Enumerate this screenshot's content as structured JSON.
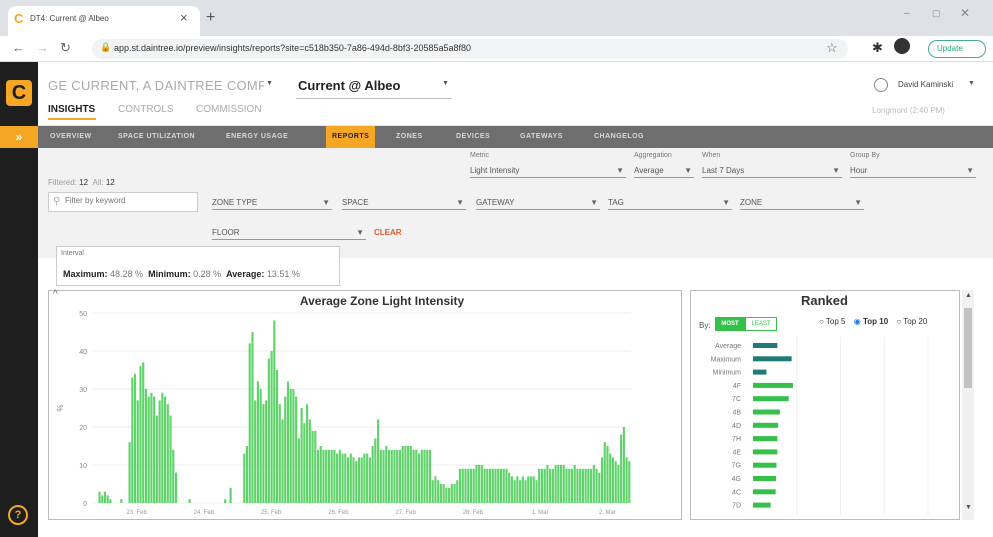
{
  "browser": {
    "tab_title": "DT4: Current @ Albeo",
    "tab_close": "×",
    "new_tab": "+",
    "url": "app.st.daintree.io/preview/insights/reports?site=c518b350-7a86-494d-8bf3-20585a5a8f80",
    "update_label": "Update"
  },
  "app": {
    "org_name": "GE CURRENT, A DAINTREE COMPANY",
    "site_name": "Current @ Albeo",
    "user_name": "David Kaminski",
    "location_time": "Longmont (2:40 PM)",
    "main_tabs": [
      "INSIGHTS",
      "CONTROLS",
      "COMMISSION"
    ],
    "sub_tabs": [
      "OVERVIEW",
      "SPACE UTILIZATION",
      "ENERGY USAGE",
      "REPORTS",
      "ZONES",
      "DEVICES",
      "GATEWAYS",
      "CHANGELOG"
    ],
    "active_sub_tab": "REPORTS"
  },
  "filters": {
    "metric_label": "Metric",
    "metric_value": "Light Intensity",
    "aggregation_label": "Aggregation",
    "aggregation_value": "Average",
    "when_label": "When",
    "when_value": "Last 7 Days",
    "groupby_label": "Group By",
    "groupby_value": "Hour",
    "filtered_label": "Filtered:",
    "filtered_count": "12",
    "all_label": "All:",
    "all_count": "12",
    "search_placeholder": "Filter by keyword",
    "zone_type": "ZONE TYPE",
    "space": "SPACE",
    "gateway": "GATEWAY",
    "tag": "TAG",
    "zone": "ZONE",
    "floor": "FLOOR",
    "clear": "CLEAR"
  },
  "interval": {
    "title": "Interval",
    "max_label": "Maximum:",
    "max_value": "48.28 %",
    "min_label": "Minimum:",
    "min_value": "0.28 %",
    "avg_label": "Average:",
    "avg_value": "13.51 %"
  },
  "ranked": {
    "title": "Ranked",
    "by_label": "By:",
    "most_label": "MOST",
    "least_label": "LEAST",
    "top_options": [
      "Top 5",
      "Top 10",
      "Top 20"
    ],
    "selected_top": "Top 10"
  },
  "colors": {
    "accent": "#f5a623",
    "bar_green": "#5fd36a",
    "ranked_green": "#35c04a",
    "ranked_teal": "#1f7a78"
  },
  "chart_data": [
    {
      "type": "bar",
      "title": "Average Zone Light Intensity",
      "ylabel": "%",
      "ylim": [
        0,
        50
      ],
      "yticks": [
        0,
        10,
        20,
        30,
        40,
        50
      ],
      "xtick_labels": [
        "23. Feb",
        "24. Feb",
        "25. Feb",
        "26. Feb",
        "27. Feb",
        "28. Feb",
        "1. Mar",
        "2. Mar"
      ],
      "values": [
        0,
        0,
        3,
        2,
        3,
        2,
        1,
        0,
        0,
        0,
        1,
        0,
        0,
        16,
        33,
        34,
        27,
        36,
        37,
        30,
        28,
        29,
        28,
        23,
        27,
        29,
        28,
        26,
        23,
        14,
        8,
        0,
        0,
        0,
        0,
        1,
        0,
        0,
        0,
        0,
        0,
        0,
        0,
        0,
        0,
        0,
        0,
        0,
        1,
        0,
        4,
        0,
        0,
        0,
        0,
        13,
        15,
        42,
        45,
        27,
        32,
        30,
        26,
        27,
        38,
        40,
        48,
        35,
        26,
        22,
        28,
        32,
        30,
        30,
        28,
        17,
        25,
        21,
        26,
        22,
        19,
        19,
        14,
        15,
        14,
        14,
        14,
        14,
        14,
        13,
        14,
        13,
        13,
        12,
        13,
        12,
        11,
        12,
        12,
        13,
        13,
        12,
        15,
        17,
        22,
        14,
        14,
        15,
        14,
        14,
        14,
        14,
        14,
        15,
        15,
        15,
        15,
        14,
        14,
        13,
        14,
        14,
        14,
        14,
        6,
        7,
        6,
        5,
        5,
        4,
        4,
        5,
        5,
        6,
        9,
        9,
        9,
        9,
        9,
        9,
        10,
        10,
        10,
        9,
        9,
        9,
        9,
        9,
        9,
        9,
        9,
        9,
        8,
        7,
        6,
        7,
        6,
        7,
        6,
        7,
        7,
        7,
        6,
        9,
        9,
        9,
        10,
        9,
        9,
        10,
        10,
        10,
        10,
        9,
        9,
        9,
        10,
        9,
        9,
        9,
        9,
        9,
        9,
        10,
        9,
        8,
        12,
        16,
        15,
        13,
        12,
        11,
        10,
        18,
        20,
        12,
        11
      ]
    },
    {
      "type": "bar",
      "title": "Ranked",
      "orientation": "horizontal",
      "categories": [
        "Average",
        "Maximum",
        "Minimum",
        "4F",
        "7C",
        "4B",
        "4D",
        "7H",
        "4E",
        "7G",
        "4G",
        "4C",
        "7D"
      ],
      "values": [
        5.8,
        9.2,
        3.2,
        9.5,
        8.5,
        6.4,
        6.0,
        5.8,
        5.8,
        5.6,
        5.5,
        5.4,
        4.2
      ]
    }
  ]
}
